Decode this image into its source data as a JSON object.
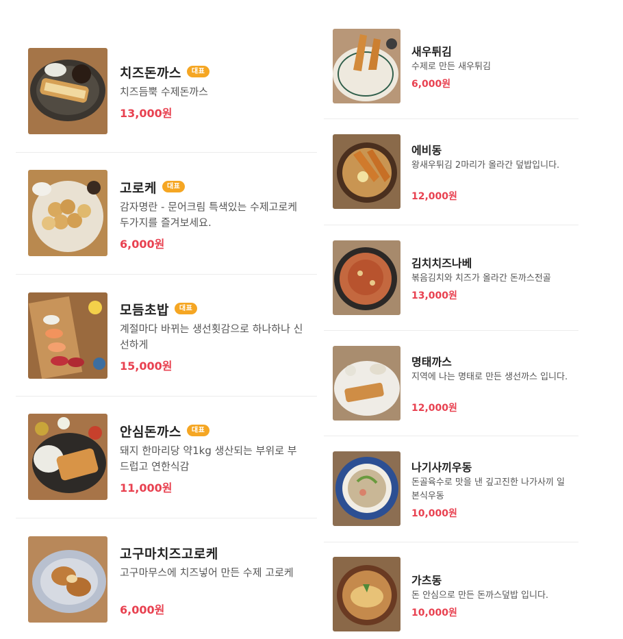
{
  "badge_label": "대표",
  "currency_suffix": "원",
  "colors": {
    "price": "#e84150",
    "badge": "#f5a623",
    "separator": "#ececec"
  },
  "left_menu": [
    {
      "name": "치즈돈까스",
      "badge": true,
      "description": "치즈듬뿍 수제돈까스",
      "price": "13,000원",
      "image": "cheese-donkatsu-photo"
    },
    {
      "name": "고로케",
      "badge": true,
      "description": "감자명란 - 문어크림 특색있는 수제고로케 두가지를 즐겨보세요.",
      "price": "6,000원",
      "image": "croquette-photo"
    },
    {
      "name": "모듬초밥",
      "badge": true,
      "description": "계절마다 바뀌는 생선횟감으로 하나하나 신선하게",
      "price": "15,000원",
      "image": "assorted-sushi-photo"
    },
    {
      "name": "안심돈까스",
      "badge": true,
      "description": "돼지 한마리당 약1kg 생산되는 부위로 부드럽고 연한식감",
      "price": "11,000원",
      "image": "tenderloin-donkatsu-photo"
    },
    {
      "name": "고구마치즈고로케",
      "badge": false,
      "description": "고구마무스에 치즈넣어 만든 수제 고로케",
      "price": "6,000원",
      "image": "sweet-potato-cheese-croquette-photo"
    }
  ],
  "right_menu": [
    {
      "name": "새우튀김",
      "description": "수제로 만든 새우튀김",
      "price": "6,000원",
      "image": "fried-shrimp-photo"
    },
    {
      "name": "에비동",
      "description": "왕새우튀김 2마리가 올라간 덮밥입니다.",
      "price": "12,000원",
      "image": "ebidon-photo"
    },
    {
      "name": "김치치즈나베",
      "description": "볶음김치와 치즈가 올라간 돈까스전골",
      "price": "13,000원",
      "image": "kimchi-cheese-nabe-photo"
    },
    {
      "name": "명태까스",
      "description": "지역에 나는 명태로 만든 생선까스 입니다.",
      "price": "12,000원",
      "image": "pollock-katsu-photo"
    },
    {
      "name": "나기사끼우동",
      "description": "돈골육수로 맛을 낸 깊고진한 나가사끼 일본식우동",
      "price": "10,000원",
      "image": "nagasaki-udon-photo"
    },
    {
      "name": "가츠동",
      "description": "돈 안심으로 만든 돈까스덮밥 입니다.",
      "price": "10,000원",
      "image": "katsudon-photo"
    }
  ]
}
